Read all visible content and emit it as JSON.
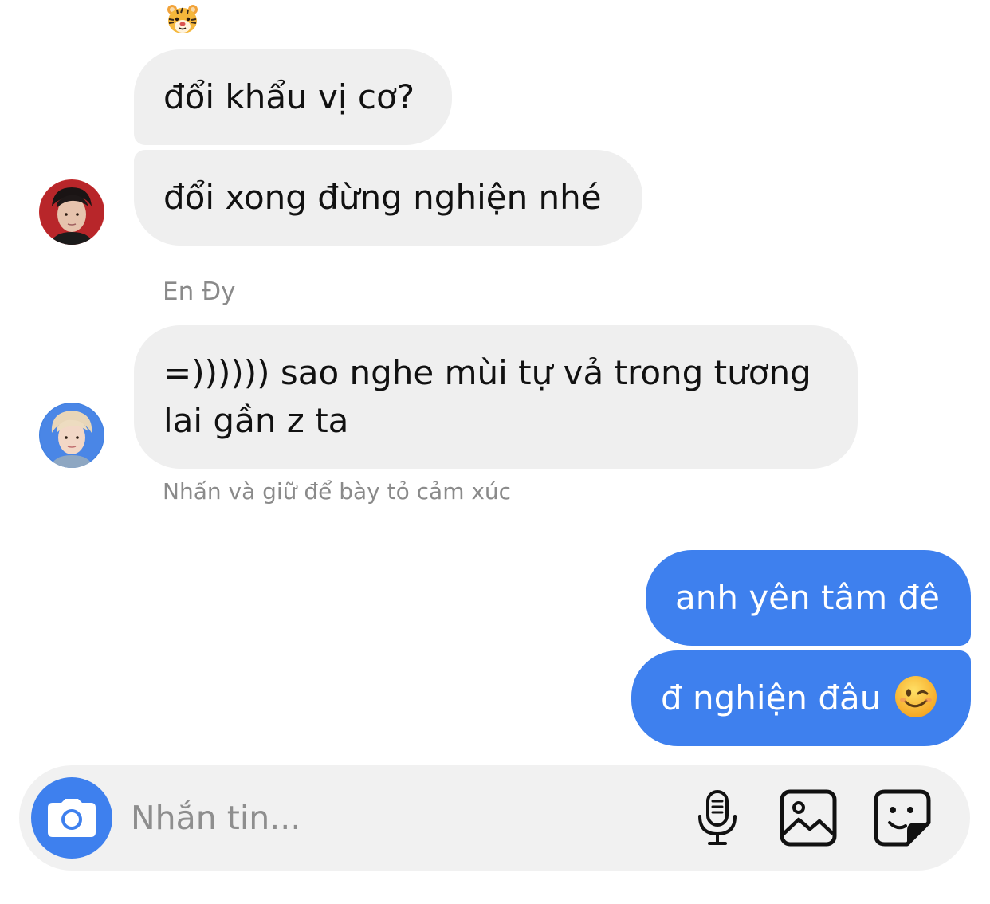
{
  "conversation": {
    "reaction_icon": "tiger-face-emoji",
    "messages": [
      {
        "text": "đổi khẩu vị cơ?"
      },
      {
        "text": "đổi xong đừng nghiện nhé"
      },
      {
        "text": "=)))))) sao nghe mùi tự vả trong tương lai gần z ta"
      },
      {
        "text": "anh yên tâm đê"
      },
      {
        "text": "đ nghiện đâu",
        "emoji": "winking-face-emoji"
      }
    ],
    "sender_name": "En Đy",
    "reaction_hint": "Nhấn và giữ để bày tỏ cảm xúc"
  },
  "composer": {
    "placeholder": "Nhắn tin...",
    "icons": [
      "camera-icon",
      "microphone-icon",
      "gallery-icon",
      "sticker-icon"
    ]
  },
  "colors": {
    "sent_bubble": "#3e80ee",
    "received_bubble": "#efefef",
    "camera_button": "#3e80ee",
    "secondary_text": "#8a8a8a",
    "composer_background": "#f1f1f1"
  }
}
